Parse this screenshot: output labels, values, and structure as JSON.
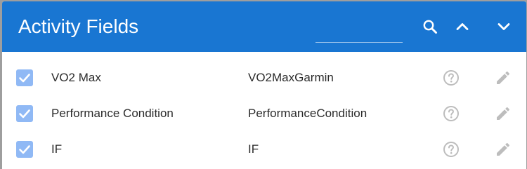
{
  "header": {
    "title": "Activity Fields",
    "search_placeholder": "",
    "icons": [
      "search-icon",
      "chevron-up-icon",
      "chevron-down-icon"
    ]
  },
  "colors": {
    "header_bg": "#1976d2",
    "checkbox": "#90b9f5",
    "action_icon": "#bdbdbd"
  },
  "rows": [
    {
      "checked": true,
      "name": "VO2 Max",
      "key": "VO2MaxGarmin"
    },
    {
      "checked": true,
      "name": "Performance Condition",
      "key": "PerformanceCondition"
    },
    {
      "checked": true,
      "name": "IF",
      "key": "IF"
    }
  ]
}
